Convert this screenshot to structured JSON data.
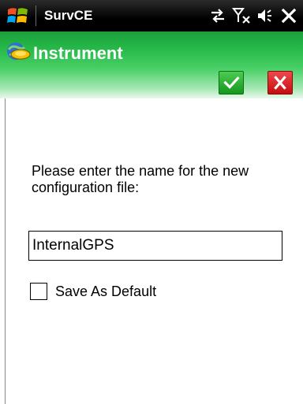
{
  "status_bar": {
    "app_name": "SurvCE",
    "icons": [
      "windows-start-icon",
      "connectivity-icon",
      "signal-off-icon",
      "volume-icon",
      "close-icon"
    ]
  },
  "header": {
    "title": "Instrument",
    "icon": "instrument-icon",
    "ok_icon": "checkmark-icon",
    "cancel_icon": "x-icon",
    "colors": {
      "band": "#25b948",
      "ok_button": "#1fa526",
      "cancel_button": "#e0181b"
    }
  },
  "form": {
    "prompt": "Please enter the name for the new configuration file:",
    "name_value": "InternalGPS",
    "save_default_label": "Save As Default",
    "save_default_checked": false
  }
}
